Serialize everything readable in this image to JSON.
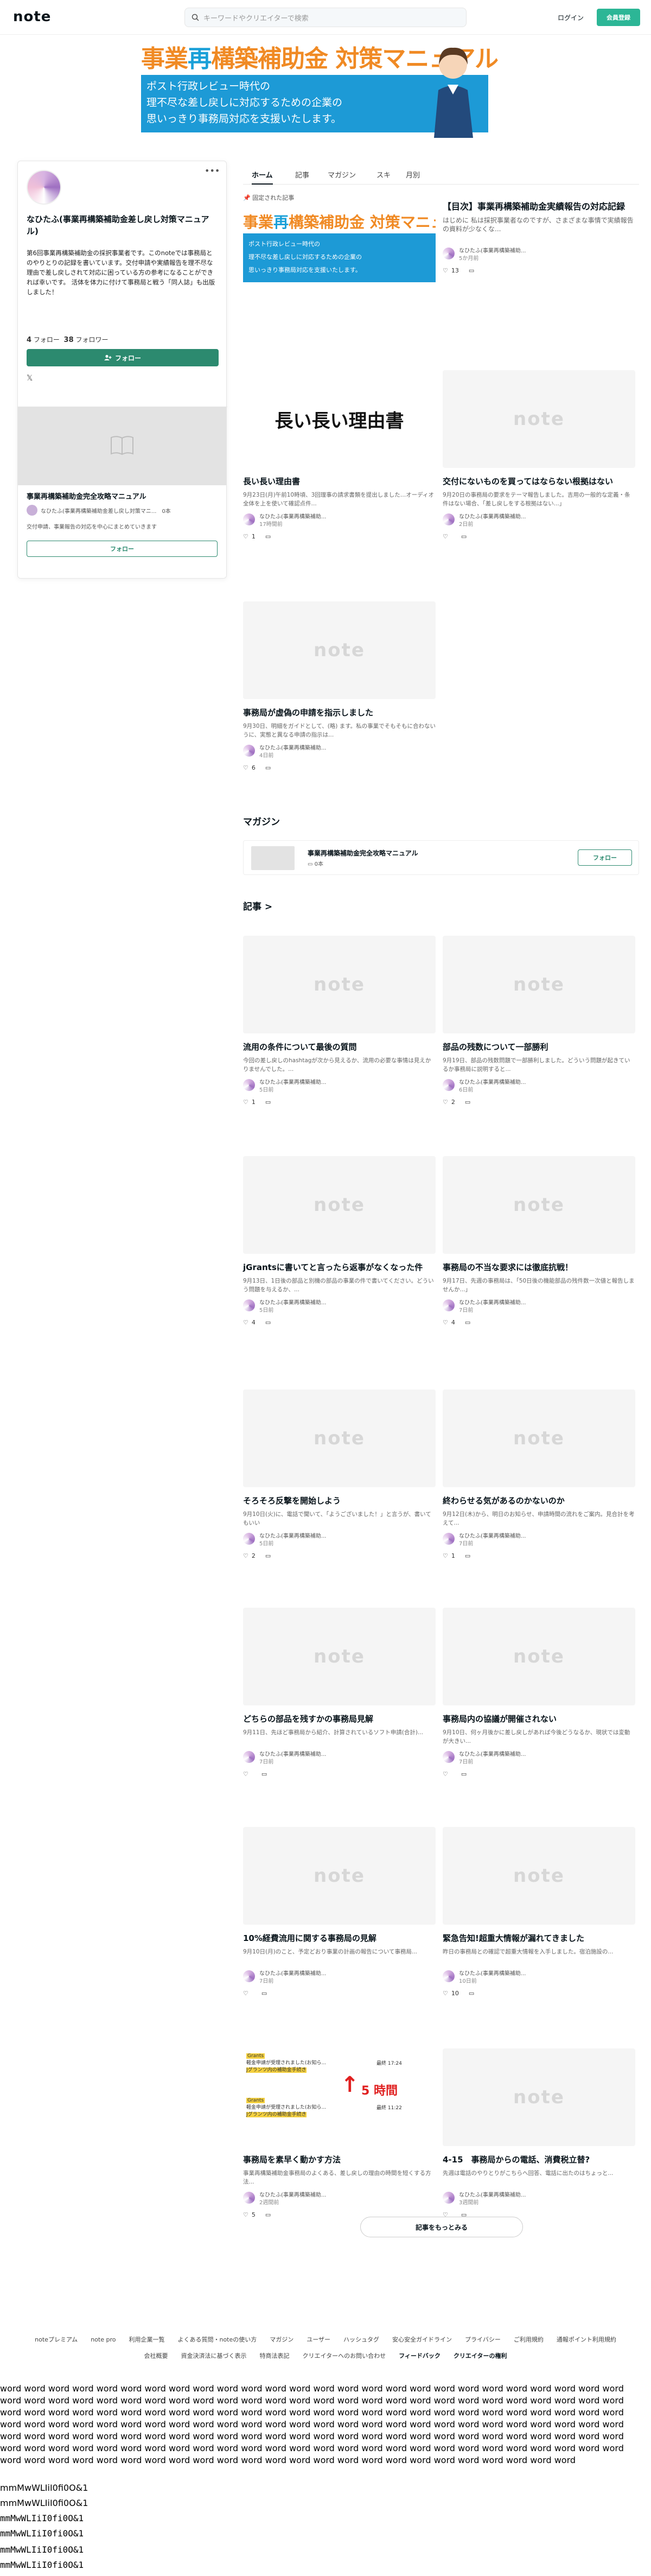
{
  "header": {
    "logo": "note",
    "search_placeholder": "キーワードやクリエイターで検索",
    "login": "ログイン",
    "signup": "会員登録"
  },
  "banner": {
    "title_a": "事業",
    "title_k": "再",
    "title_b": "構築補助金 対策マニュアル",
    "line1": "ポスト行政レビュー時代の",
    "line2": "理不尽な差し戻しに対応するための企業の",
    "line3": "思いっきり事務局対応を支援いたします。"
  },
  "profile": {
    "name": "なひたふ(事業再構築補助金差し戻し対策マニュアル)",
    "bio": "第6回事業再構築補助金の採択事業者です。このnoteでは事務局とのやりとりの記録を書いています。交付申請や実績報告を理不尽な理由で差し戻しされて対応に困っている方の参考になることができれば幸いです。 活体を体力に付けて事務局と戦う「同人誌」も出版しました！",
    "following_count": "4",
    "following_label": "フォロー",
    "followers_count": "38",
    "followers_label": "フォロワー",
    "follow_button": "フォロー",
    "x_label": "𝕏",
    "magazine": {
      "title": "事業再構築補助金完全攻略マニュアル",
      "author": "なひたふ(事業再構築補助金差し戻し対策マニ...",
      "count": "0本",
      "desc": "交付申請、事業報告の対応を中心にまとめていきます",
      "follow": "フォロー"
    }
  },
  "tabs": [
    "ホーム",
    "記事",
    "マガジン",
    "スキ",
    "月別"
  ],
  "pinned_label": "固定された記事",
  "author_short": "なひたふ(事業再構築補助...",
  "pinned_articles": [
    {
      "title": "",
      "excerpt": "",
      "time": "",
      "likes": "",
      "banner": true
    },
    {
      "title": "【目次】事業再構築補助金実績報告の対応記録",
      "excerpt": "はじめに 私は採択事業者なのですが、さまざまな事情で実績報告の資料が少なくな...",
      "time": "5か月前",
      "likes": "13"
    },
    {
      "title": "長い長い理由書",
      "excerpt": "9月23日(月)午前10時頃、3回理事の請求書類を提出しました…オーディオ全体を上を使いて確認点件...",
      "time": "17時間前",
      "likes": "1",
      "thumb_text": "長い長い理由書"
    },
    {
      "title": "交付にないものを買ってはならない根拠はない",
      "excerpt": "9月20日の事務局の要求をテーマ報告しました。吉用の一般的な定義・条件はない場合、「差し戻しをする根拠はない...」",
      "time": "2日前",
      "likes": ""
    },
    {
      "title": "事務局が虚偽の申請を指示しました",
      "excerpt": "9月30日、明細をガイドとして、(略) ます。私の事業でそもそもに合わないうに、実態と異なる申請の指示は...",
      "time": "4日前",
      "likes": "6"
    }
  ],
  "magazine_section": {
    "heading": "マガジン",
    "title": "事業再構築補助金完全攻略マニュアル",
    "count": "0本",
    "follow": "フォロー"
  },
  "articles_heading": "記事 >",
  "articles": [
    {
      "title": "流用の条件について最後の質問",
      "excerpt": "今回の差し戻しのhashtagが次から見えるか、流用の必要な事情は見えかりませんでした。...",
      "time": "5日前",
      "likes": "1"
    },
    {
      "title": "部品の残数について一部勝利",
      "excerpt": "9月19日、部品の残数問題で一部勝利しました。どういう問題が起きているか事務局に説明すると...",
      "time": "6日前",
      "likes": "2"
    },
    {
      "title": "jGrantsに書いてと言ったら返事がなくなった件",
      "excerpt": "9月13日、1日後の部品と別機の部品の事業の件で書いてください。どういう問題を与えるか、...",
      "time": "5日前",
      "likes": "4"
    },
    {
      "title": "事務局の不当な要求には徹底抗戦！",
      "excerpt": "9月17日、先週の事務局は、「50日後の機能部品の残件数一次値と報告しませんか...」",
      "time": "7日前",
      "likes": "4"
    },
    {
      "title": "そろそろ反撃を開始しよう",
      "excerpt": "9月10日(火)に、電話で聞いて、「ようございました！」と言うが、書いてもいい",
      "time": "5日前",
      "likes": "2"
    },
    {
      "title": "終わらせる気があるのかないのか",
      "excerpt": "9月12日(木)から、明日のお知らせ、申請時間の流れをご案内。見合計を考えて...",
      "time": "7日前",
      "likes": "1"
    },
    {
      "title": "どちらの部品を残すかの事務局見解",
      "excerpt": "9月11日、先ほど事務局から紹介、計算されているソフト申請(合計)...",
      "time": "7日前",
      "likes": ""
    },
    {
      "title": "事務局内の協議が開催されない",
      "excerpt": "9月10日、何ヶ月後かに差し戻しがあれば今後どうなるか、現状では変動が大きい...",
      "time": "7日前",
      "likes": ""
    },
    {
      "title": "10%経費流用に関する事務局の見解",
      "excerpt": "9月10日(月)のこと、予定どおり事業の計画の報告について事務局...",
      "time": "7日前",
      "likes": ""
    },
    {
      "title": "緊急告知!超重大情報が漏れてきました",
      "excerpt": "昨日の事務局との確認で超重大情報を入手しました。宿泊施設の...",
      "time": "10日前",
      "likes": "10"
    },
    {
      "title": "事務局を素早く動かす方法",
      "excerpt": "事業再構築補助金事務局のよくある、差し戻しの理由の時間を短くする方法...",
      "time": "2週間前",
      "likes": "5",
      "thumb_special": true
    },
    {
      "title": "4-15　事務局からの電話、消費税立替?",
      "excerpt": "先週は電話のやりとりがこちらへ回答、電話に出たのはちょっと...",
      "time": "3週間前",
      "likes": ""
    }
  ],
  "thumb_special": {
    "tag1": "Grants",
    "line1": "軽金申請が受理されました(お知ら...",
    "line1b": "Jグランツ内の補助金手続き",
    "time1": "最終 17:24",
    "tag2": "Grants",
    "line2": "軽金申請が受理されました(お知ら...",
    "line2b": "Jグランツ内の補助金手続き",
    "time2": "最終 11:22",
    "note": "5 時間"
  },
  "more_button": "記事をもっとみる",
  "footer": {
    "row1": [
      "noteプレミアム",
      "note pro",
      "利用企業一覧",
      "よくある質問・noteの使い方",
      "マガジン",
      "ユーザー",
      "ハッシュタグ",
      "安心安全ガイドライン",
      "プライバシー",
      "ご利用規約",
      "通報ポイント利用規約"
    ],
    "row2": [
      "会社概要",
      "資金決済法に基づく表示",
      "特商法表記",
      "クリエイターへのお問い合わせ",
      "フィードバック",
      "クリエイターの権利"
    ]
  },
  "filler_word": "word",
  "filler_mono": "mmMwWLIiI0fi0O&1"
}
